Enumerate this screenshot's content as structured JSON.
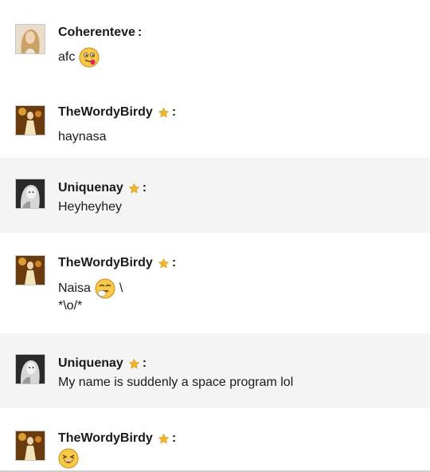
{
  "messages": [
    {
      "user": "Coherenteve",
      "starred": false,
      "colon": ":",
      "lines": [
        "afc"
      ],
      "emoji": "tongue-out-emoji",
      "avatar": "avatar-blonde-woman"
    },
    {
      "user": "TheWordyBirdy",
      "starred": true,
      "colon": ":",
      "lines": [
        "haynasa"
      ],
      "avatar": "avatar-golden-stage"
    },
    {
      "user": "Uniquenay",
      "starred": true,
      "colon": ":",
      "lines": [
        "Heyheyhey"
      ],
      "avatar": "avatar-bw-woman"
    },
    {
      "user": "TheWordyBirdy",
      "starred": true,
      "colon": ":",
      "lines": [
        "Naisa",
        "\\",
        "*\\o/*"
      ],
      "emoji": "giggle-emoji",
      "avatar": "avatar-golden-stage"
    },
    {
      "user": "Uniquenay",
      "starred": true,
      "colon": ":",
      "lines": [
        "My name is suddenly a space program lol"
      ],
      "avatar": "avatar-bw-woman"
    },
    {
      "user": "TheWordyBirdy",
      "starred": true,
      "colon": ":",
      "lines": [],
      "emoji": "laughing-emoji",
      "avatar": "avatar-golden-stage"
    }
  ],
  "colors": {
    "alt_row_background": "#f4f4f4",
    "star": "#f0b429",
    "emoji_face": "#f7c948"
  }
}
